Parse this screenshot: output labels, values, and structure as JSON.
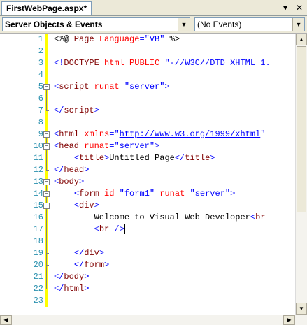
{
  "tab": {
    "title": "FirstWebPage.aspx*"
  },
  "window_controls": {
    "dropdown": "▾",
    "close": "✕"
  },
  "toolbar": {
    "objects_value": "Server Objects & Events",
    "events_value": "(No Events)",
    "arrow": "▼"
  },
  "colors": {
    "keyword": "#0000ff",
    "tag": "#800000",
    "attr": "#ff0000",
    "text": "#000000",
    "aspdelim": "#000000",
    "changebar": "#ffff00",
    "linenumber": "#2b91af"
  },
  "code_lines": [
    {
      "num": "1",
      "outline": "none",
      "tokens": [
        {
          "t": "<%@",
          "c": "aspdelim"
        },
        {
          "t": " Page",
          "c": "tag"
        },
        {
          "t": " Language",
          "c": "attr"
        },
        {
          "t": "=",
          "c": "keyword"
        },
        {
          "t": "\"VB\"",
          "c": "keyword"
        },
        {
          "t": " %>",
          "c": "aspdelim"
        }
      ]
    },
    {
      "num": "2",
      "outline": "none",
      "tokens": []
    },
    {
      "num": "3",
      "outline": "none",
      "tokens": [
        {
          "t": "<!",
          "c": "keyword"
        },
        {
          "t": "DOCTYPE",
          "c": "tag"
        },
        {
          "t": " html",
          "c": "attr"
        },
        {
          "t": " PUBLIC",
          "c": "attr"
        },
        {
          "t": " \"-//W3C//DTD XHTML 1.",
          "c": "keyword"
        }
      ]
    },
    {
      "num": "4",
      "outline": "none",
      "tokens": []
    },
    {
      "num": "5",
      "outline": "start",
      "tokens": [
        {
          "t": "<",
          "c": "keyword"
        },
        {
          "t": "script",
          "c": "tag"
        },
        {
          "t": " runat",
          "c": "attr"
        },
        {
          "t": "=",
          "c": "keyword"
        },
        {
          "t": "\"server\"",
          "c": "keyword"
        },
        {
          "t": ">",
          "c": "keyword"
        }
      ]
    },
    {
      "num": "6",
      "outline": "line",
      "tokens": []
    },
    {
      "num": "7",
      "outline": "end",
      "tokens": [
        {
          "t": "</",
          "c": "keyword"
        },
        {
          "t": "script",
          "c": "tag"
        },
        {
          "t": ">",
          "c": "keyword"
        }
      ]
    },
    {
      "num": "8",
      "outline": "none",
      "tokens": []
    },
    {
      "num": "9",
      "outline": "start",
      "tokens": [
        {
          "t": "<",
          "c": "keyword"
        },
        {
          "t": "html",
          "c": "tag"
        },
        {
          "t": " xmlns",
          "c": "attr"
        },
        {
          "t": "=",
          "c": "keyword"
        },
        {
          "t": "\"",
          "c": "keyword"
        },
        {
          "t": "http://www.w3.org/1999/xhtml",
          "c": "keyword",
          "u": true
        },
        {
          "t": "\"",
          "c": "keyword"
        }
      ]
    },
    {
      "num": "10",
      "outline": "start",
      "tokens": [
        {
          "t": "<",
          "c": "keyword"
        },
        {
          "t": "head",
          "c": "tag"
        },
        {
          "t": " runat",
          "c": "attr"
        },
        {
          "t": "=",
          "c": "keyword"
        },
        {
          "t": "\"server\"",
          "c": "keyword"
        },
        {
          "t": ">",
          "c": "keyword"
        }
      ]
    },
    {
      "num": "11",
      "outline": "line",
      "tokens": [
        {
          "t": "    ",
          "c": "text"
        },
        {
          "t": "<",
          "c": "keyword"
        },
        {
          "t": "title",
          "c": "tag"
        },
        {
          "t": ">",
          "c": "keyword"
        },
        {
          "t": "Untitled Page",
          "c": "text"
        },
        {
          "t": "</",
          "c": "keyword"
        },
        {
          "t": "title",
          "c": "tag"
        },
        {
          "t": ">",
          "c": "keyword"
        }
      ]
    },
    {
      "num": "12",
      "outline": "end",
      "tokens": [
        {
          "t": "</",
          "c": "keyword"
        },
        {
          "t": "head",
          "c": "tag"
        },
        {
          "t": ">",
          "c": "keyword"
        }
      ]
    },
    {
      "num": "13",
      "outline": "start",
      "tokens": [
        {
          "t": "<",
          "c": "keyword"
        },
        {
          "t": "body",
          "c": "tag"
        },
        {
          "t": ">",
          "c": "keyword"
        }
      ]
    },
    {
      "num": "14",
      "outline": "start",
      "tokens": [
        {
          "t": "    ",
          "c": "text"
        },
        {
          "t": "<",
          "c": "keyword"
        },
        {
          "t": "form",
          "c": "tag"
        },
        {
          "t": " id",
          "c": "attr"
        },
        {
          "t": "=",
          "c": "keyword"
        },
        {
          "t": "\"form1\"",
          "c": "keyword"
        },
        {
          "t": " runat",
          "c": "attr"
        },
        {
          "t": "=",
          "c": "keyword"
        },
        {
          "t": "\"server\"",
          "c": "keyword"
        },
        {
          "t": ">",
          "c": "keyword"
        }
      ]
    },
    {
      "num": "15",
      "outline": "start",
      "tokens": [
        {
          "t": "    ",
          "c": "text"
        },
        {
          "t": "<",
          "c": "keyword"
        },
        {
          "t": "div",
          "c": "tag"
        },
        {
          "t": ">",
          "c": "keyword"
        }
      ]
    },
    {
      "num": "16",
      "outline": "line",
      "tokens": [
        {
          "t": "        Welcome to Visual Web Developer",
          "c": "text"
        },
        {
          "t": "<",
          "c": "keyword"
        },
        {
          "t": "br",
          "c": "tag"
        }
      ]
    },
    {
      "num": "17",
      "outline": "line",
      "cursor": true,
      "tokens": [
        {
          "t": "        ",
          "c": "text"
        },
        {
          "t": "<",
          "c": "keyword"
        },
        {
          "t": "br",
          "c": "tag"
        },
        {
          "t": " />",
          "c": "keyword"
        }
      ]
    },
    {
      "num": "18",
      "outline": "line",
      "tokens": []
    },
    {
      "num": "19",
      "outline": "end",
      "tokens": [
        {
          "t": "    ",
          "c": "text"
        },
        {
          "t": "</",
          "c": "keyword"
        },
        {
          "t": "div",
          "c": "tag"
        },
        {
          "t": ">",
          "c": "keyword"
        }
      ]
    },
    {
      "num": "20",
      "outline": "end",
      "tokens": [
        {
          "t": "    ",
          "c": "text"
        },
        {
          "t": "</",
          "c": "keyword"
        },
        {
          "t": "form",
          "c": "tag"
        },
        {
          "t": ">",
          "c": "keyword"
        }
      ]
    },
    {
      "num": "21",
      "outline": "end",
      "tokens": [
        {
          "t": "</",
          "c": "keyword"
        },
        {
          "t": "body",
          "c": "tag"
        },
        {
          "t": ">",
          "c": "keyword"
        }
      ]
    },
    {
      "num": "22",
      "outline": "end",
      "tokens": [
        {
          "t": "</",
          "c": "keyword"
        },
        {
          "t": "html",
          "c": "tag"
        },
        {
          "t": ">",
          "c": "keyword"
        }
      ]
    },
    {
      "num": "23",
      "outline": "none",
      "tokens": []
    }
  ],
  "scrollbar": {
    "up": "▲",
    "down": "▼",
    "left": "◀",
    "right": "▶"
  }
}
